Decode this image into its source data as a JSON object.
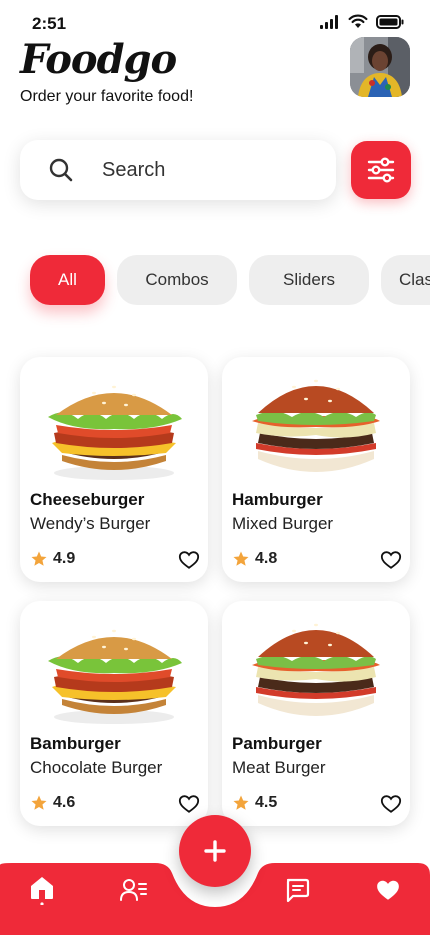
{
  "status": {
    "time": "2:51"
  },
  "header": {
    "brand": "Foodgo",
    "tagline": "Order your favorite food!"
  },
  "search": {
    "placeholder": "Search"
  },
  "categories": [
    "All",
    "Combos",
    "Sliders",
    "Clas"
  ],
  "products": [
    {
      "name": "Cheeseburger",
      "subtitle": "Wendy’s Burger",
      "rating": "4.9"
    },
    {
      "name": "Hamburger",
      "subtitle": "Mixed Burger",
      "rating": "4.8"
    },
    {
      "name": "Bamburger",
      "subtitle": "Chocolate Burger",
      "rating": "4.6"
    },
    {
      "name": "Pamburger",
      "subtitle": "Meat Burger",
      "rating": "4.5"
    }
  ],
  "colors": {
    "accent": "#ef2a39",
    "star": "#f3a43b",
    "chip_bg": "#eeeeee"
  },
  "icons": [
    "search-icon",
    "sliders-icon",
    "star-icon",
    "heart-outline-icon",
    "plus-icon",
    "home-icon",
    "profile-icon",
    "chat-icon",
    "heart-filled-icon"
  ]
}
